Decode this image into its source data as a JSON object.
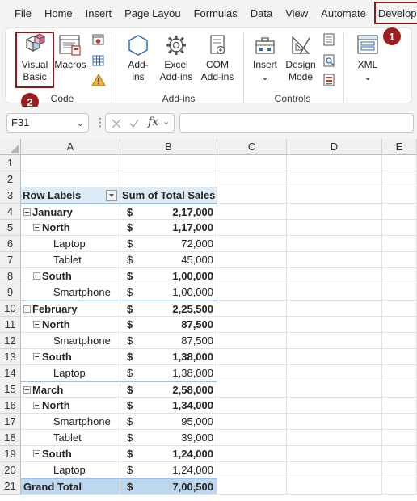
{
  "tabs": [
    "File",
    "Home",
    "Insert",
    "Page Layou",
    "Formulas",
    "Data",
    "View",
    "Automate",
    "Developer"
  ],
  "ribbon": {
    "code_group": {
      "label": "Code",
      "visual_basic_line1": "Visual",
      "visual_basic_line2": "Basic",
      "macros": "Macros"
    },
    "addins_group": {
      "label": "Add-ins",
      "addins_line1": "Add-",
      "addins_line2": "ins",
      "excel_addins_line1": "Excel",
      "excel_addins_line2": "Add-ins",
      "com_addins_line1": "COM",
      "com_addins_line2": "Add-ins"
    },
    "controls_group": {
      "label": "Controls",
      "insert": "Insert",
      "insert_arrow": "⌄",
      "design_mode_line1": "Design",
      "design_mode_line2": "Mode"
    },
    "xml_group": {
      "xml": "XML",
      "xml_arrow": "⌄"
    }
  },
  "badges": {
    "one": "1",
    "two": "2"
  },
  "formula_bar": {
    "name_box": "F31",
    "fx": "fx",
    "dots": "⋮",
    "dropdown": "⌄",
    "value": ""
  },
  "columns": [
    "A",
    "B",
    "C",
    "D",
    "E"
  ],
  "pivot": {
    "header": {
      "row": "3",
      "label": "Row Labels",
      "value_label": "Sum of Total Sales"
    },
    "rows": [
      {
        "row": "4",
        "label": "January",
        "level": 0,
        "bold": true,
        "toggle": true,
        "dollar": "$",
        "amount": "2,17,000"
      },
      {
        "row": "5",
        "label": "North",
        "level": 1,
        "bold": true,
        "toggle": true,
        "dollar": "$",
        "amount": "1,17,000"
      },
      {
        "row": "6",
        "label": "Laptop",
        "level": 2,
        "bold": false,
        "toggle": false,
        "dollar": "$",
        "amount": "72,000"
      },
      {
        "row": "7",
        "label": "Tablet",
        "level": 2,
        "bold": false,
        "toggle": false,
        "dollar": "$",
        "amount": "45,000"
      },
      {
        "row": "8",
        "label": "South",
        "level": 1,
        "bold": true,
        "toggle": true,
        "dollar": "$",
        "amount": "1,00,000"
      },
      {
        "row": "9",
        "label": "Smartphone",
        "level": 2,
        "bold": false,
        "toggle": false,
        "dollar": "$",
        "amount": "1,00,000"
      },
      {
        "row": "10",
        "label": "February",
        "level": 0,
        "bold": true,
        "toggle": true,
        "dollar": "$",
        "amount": "2,25,500"
      },
      {
        "row": "11",
        "label": "North",
        "level": 1,
        "bold": true,
        "toggle": true,
        "dollar": "$",
        "amount": "87,500"
      },
      {
        "row": "12",
        "label": "Smartphone",
        "level": 2,
        "bold": false,
        "toggle": false,
        "dollar": "$",
        "amount": "87,500"
      },
      {
        "row": "13",
        "label": "South",
        "level": 1,
        "bold": true,
        "toggle": true,
        "dollar": "$",
        "amount": "1,38,000"
      },
      {
        "row": "14",
        "label": "Laptop",
        "level": 2,
        "bold": false,
        "toggle": false,
        "dollar": "$",
        "amount": "1,38,000"
      },
      {
        "row": "15",
        "label": "March",
        "level": 0,
        "bold": true,
        "toggle": true,
        "dollar": "$",
        "amount": "2,58,000"
      },
      {
        "row": "16",
        "label": "North",
        "level": 1,
        "bold": true,
        "toggle": true,
        "dollar": "$",
        "amount": "1,34,000"
      },
      {
        "row": "17",
        "label": "Smartphone",
        "level": 2,
        "bold": false,
        "toggle": false,
        "dollar": "$",
        "amount": "95,000"
      },
      {
        "row": "18",
        "label": "Tablet",
        "level": 2,
        "bold": false,
        "toggle": false,
        "dollar": "$",
        "amount": "39,000"
      },
      {
        "row": "19",
        "label": "South",
        "level": 1,
        "bold": true,
        "toggle": true,
        "dollar": "$",
        "amount": "1,24,000"
      },
      {
        "row": "20",
        "label": "Laptop",
        "level": 2,
        "bold": false,
        "toggle": false,
        "dollar": "$",
        "amount": "1,24,000"
      }
    ],
    "grand_total": {
      "row": "21",
      "label": "Grand Total",
      "dollar": "$",
      "amount": "7,00,500"
    }
  },
  "empty_rows": [
    "1",
    "2"
  ],
  "colors": {
    "pivot_header": "#ddebf7",
    "grand_total": "#bdd7ee",
    "highlight_box": "#8b1a1a",
    "badge": "#9c1e1e"
  }
}
